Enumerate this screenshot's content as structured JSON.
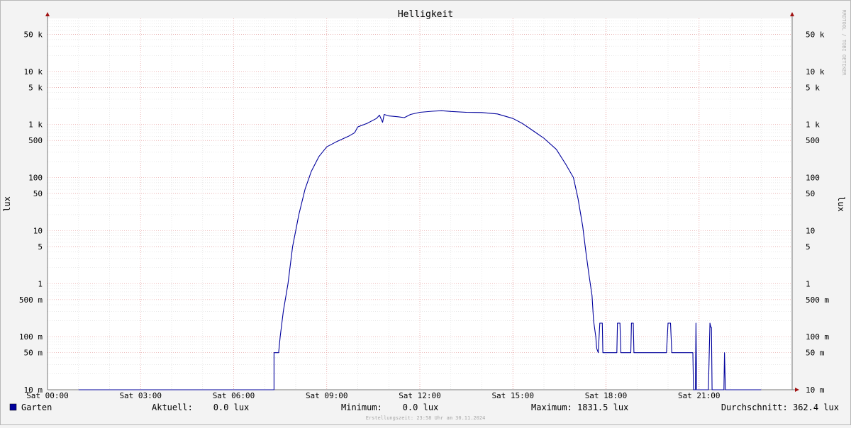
{
  "chart_data": {
    "type": "line",
    "title": "Helligkeit",
    "ylabel": "lux",
    "ylabel_right": "lux",
    "watermark": "RRDTOOL / TOBI OETIKER",
    "y_scale": "log",
    "ylim": [
      0.01,
      100000
    ],
    "y_ticks": [
      {
        "value": 50000,
        "label": "50 k"
      },
      {
        "value": 10000,
        "label": "10 k"
      },
      {
        "value": 5000,
        "label": "5 k"
      },
      {
        "value": 1000,
        "label": "1 k"
      },
      {
        "value": 500,
        "label": "500"
      },
      {
        "value": 100,
        "label": "100"
      },
      {
        "value": 50,
        "label": "50"
      },
      {
        "value": 10,
        "label": "10"
      },
      {
        "value": 5,
        "label": "5"
      },
      {
        "value": 1,
        "label": "1"
      },
      {
        "value": 0.5,
        "label": "500 m"
      },
      {
        "value": 0.1,
        "label": "100 m"
      },
      {
        "value": 0.05,
        "label": "50 m"
      },
      {
        "value": 0.01,
        "label": "10 m"
      }
    ],
    "xlim": [
      0,
      24
    ],
    "x_unit": "hour of day",
    "x_ticks": [
      {
        "value": 0,
        "label": "Sat 00:00"
      },
      {
        "value": 3,
        "label": "Sat 03:00"
      },
      {
        "value": 6,
        "label": "Sat 06:00"
      },
      {
        "value": 9,
        "label": "Sat 09:00"
      },
      {
        "value": 12,
        "label": "Sat 12:00"
      },
      {
        "value": 15,
        "label": "Sat 15:00"
      },
      {
        "value": 18,
        "label": "Sat 18:00"
      },
      {
        "value": 21,
        "label": "Sat 21:00"
      }
    ],
    "grid": true,
    "series": [
      {
        "name": "Garten",
        "color": "#00009c",
        "points": [
          [
            1.0,
            0.01
          ],
          [
            7.3,
            0.01
          ],
          [
            7.3,
            0.05
          ],
          [
            7.45,
            0.05
          ],
          [
            7.5,
            0.1
          ],
          [
            7.6,
            0.3
          ],
          [
            7.75,
            1.0
          ],
          [
            7.9,
            5.0
          ],
          [
            8.1,
            20
          ],
          [
            8.3,
            60
          ],
          [
            8.5,
            130
          ],
          [
            8.75,
            250
          ],
          [
            9.0,
            380
          ],
          [
            9.3,
            470
          ],
          [
            9.7,
            600
          ],
          [
            9.9,
            700
          ],
          [
            10.0,
            900
          ],
          [
            10.3,
            1050
          ],
          [
            10.6,
            1300
          ],
          [
            10.7,
            1500
          ],
          [
            10.8,
            1100
          ],
          [
            10.85,
            1550
          ],
          [
            11.0,
            1450
          ],
          [
            11.3,
            1400
          ],
          [
            11.5,
            1350
          ],
          [
            11.7,
            1550
          ],
          [
            12.0,
            1700
          ],
          [
            12.4,
            1780
          ],
          [
            12.7,
            1820
          ],
          [
            13.0,
            1760
          ],
          [
            13.5,
            1700
          ],
          [
            14.0,
            1680
          ],
          [
            14.5,
            1580
          ],
          [
            15.0,
            1300
          ],
          [
            15.3,
            1050
          ],
          [
            15.6,
            800
          ],
          [
            16.0,
            550
          ],
          [
            16.4,
            340
          ],
          [
            16.7,
            180
          ],
          [
            16.95,
            100
          ],
          [
            17.1,
            40
          ],
          [
            17.25,
            12
          ],
          [
            17.35,
            4.0
          ],
          [
            17.45,
            1.5
          ],
          [
            17.55,
            0.6
          ],
          [
            17.6,
            0.2
          ],
          [
            17.67,
            0.1
          ],
          [
            17.7,
            0.06
          ],
          [
            17.75,
            0.05
          ],
          [
            17.8,
            0.18
          ],
          [
            17.88,
            0.18
          ],
          [
            17.9,
            0.05
          ],
          [
            18.35,
            0.05
          ],
          [
            18.37,
            0.18
          ],
          [
            18.45,
            0.18
          ],
          [
            18.48,
            0.05
          ],
          [
            18.8,
            0.05
          ],
          [
            18.82,
            0.18
          ],
          [
            18.88,
            0.18
          ],
          [
            18.9,
            0.05
          ],
          [
            19.95,
            0.05
          ],
          [
            20.0,
            0.18
          ],
          [
            20.08,
            0.18
          ],
          [
            20.12,
            0.05
          ],
          [
            20.8,
            0.05
          ],
          [
            20.82,
            0.01
          ],
          [
            20.88,
            0.01
          ],
          [
            20.9,
            0.18
          ],
          [
            20.92,
            0.01
          ],
          [
            21.3,
            0.01
          ],
          [
            21.35,
            0.18
          ],
          [
            21.38,
            0.15
          ],
          [
            21.4,
            0.15
          ],
          [
            21.42,
            0.01
          ],
          [
            21.8,
            0.01
          ],
          [
            21.82,
            0.05
          ],
          [
            21.85,
            0.01
          ],
          [
            23.0,
            0.01
          ]
        ]
      }
    ],
    "legend_placement": "bottom"
  },
  "legend": {
    "series_name": "Garten",
    "swatch_color": "#00009c",
    "current": "Aktuell:    0.0 lux",
    "minimum": "Minimum:    0.0 lux",
    "maximum": "Maximum: 1831.5 lux",
    "average": "Durchschnitt: 362.4 lux"
  },
  "footer": "Erstellungszeit: 23:58 Uhr am 30.11.2024"
}
